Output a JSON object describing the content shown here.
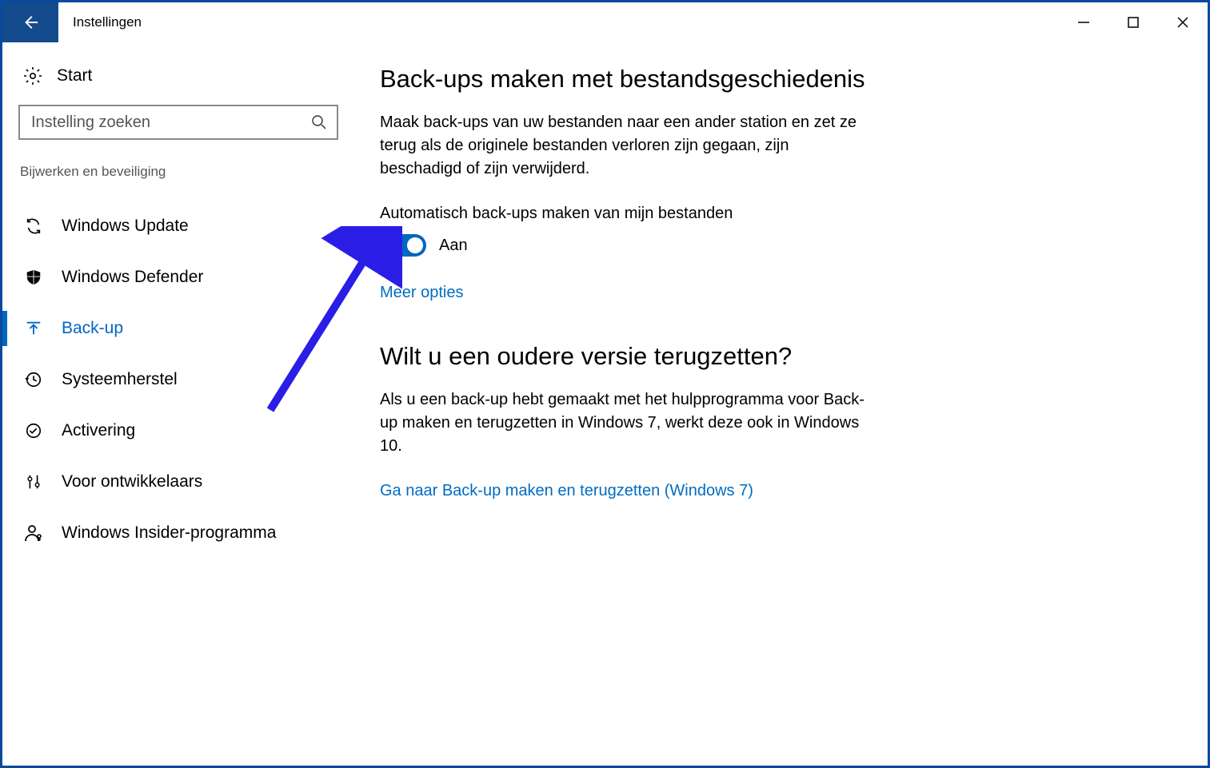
{
  "window": {
    "title": "Instellingen"
  },
  "sidebar": {
    "start_label": "Start",
    "search_placeholder": "Instelling zoeken",
    "category": "Bijwerken en beveiliging",
    "items": [
      {
        "id": "windows-update",
        "label": "Windows Update",
        "icon": "refresh-icon",
        "active": false
      },
      {
        "id": "windows-defender",
        "label": "Windows Defender",
        "icon": "shield-icon",
        "active": false
      },
      {
        "id": "back-up",
        "label": "Back-up",
        "icon": "upload-arrow-icon",
        "active": true
      },
      {
        "id": "systeemherstel",
        "label": "Systeemherstel",
        "icon": "history-icon",
        "active": false
      },
      {
        "id": "activering",
        "label": "Activering",
        "icon": "check-circle-icon",
        "active": false
      },
      {
        "id": "voor-ontwikkelaars",
        "label": "Voor ontwikkelaars",
        "icon": "sliders-icon",
        "active": false
      },
      {
        "id": "windows-insider",
        "label": "Windows Insider-programma",
        "icon": "person-key-icon",
        "active": false
      }
    ]
  },
  "content": {
    "heading1": "Back-ups maken met bestandsgeschiedenis",
    "desc1": "Maak back-ups van uw bestanden naar een ander station en zet ze terug als de originele bestanden verloren zijn gegaan, zijn beschadigd of zijn verwijderd.",
    "toggle_label": "Automatisch back-ups maken van mijn bestanden",
    "toggle_state": "Aan",
    "toggle_on": true,
    "more_options": "Meer opties",
    "heading2": "Wilt u een oudere versie terugzetten?",
    "desc2": "Als u een back-up hebt gemaakt met het hulpprogramma voor Back-up maken en terugzetten in Windows 7, werkt deze ook in Windows 10.",
    "link2": "Ga naar Back-up maken en terugzetten (Windows 7)"
  },
  "colors": {
    "accent": "#0067c0",
    "titlebar_back": "#144b8c",
    "link": "#006cc1",
    "annotation": "#2a1ee6"
  }
}
